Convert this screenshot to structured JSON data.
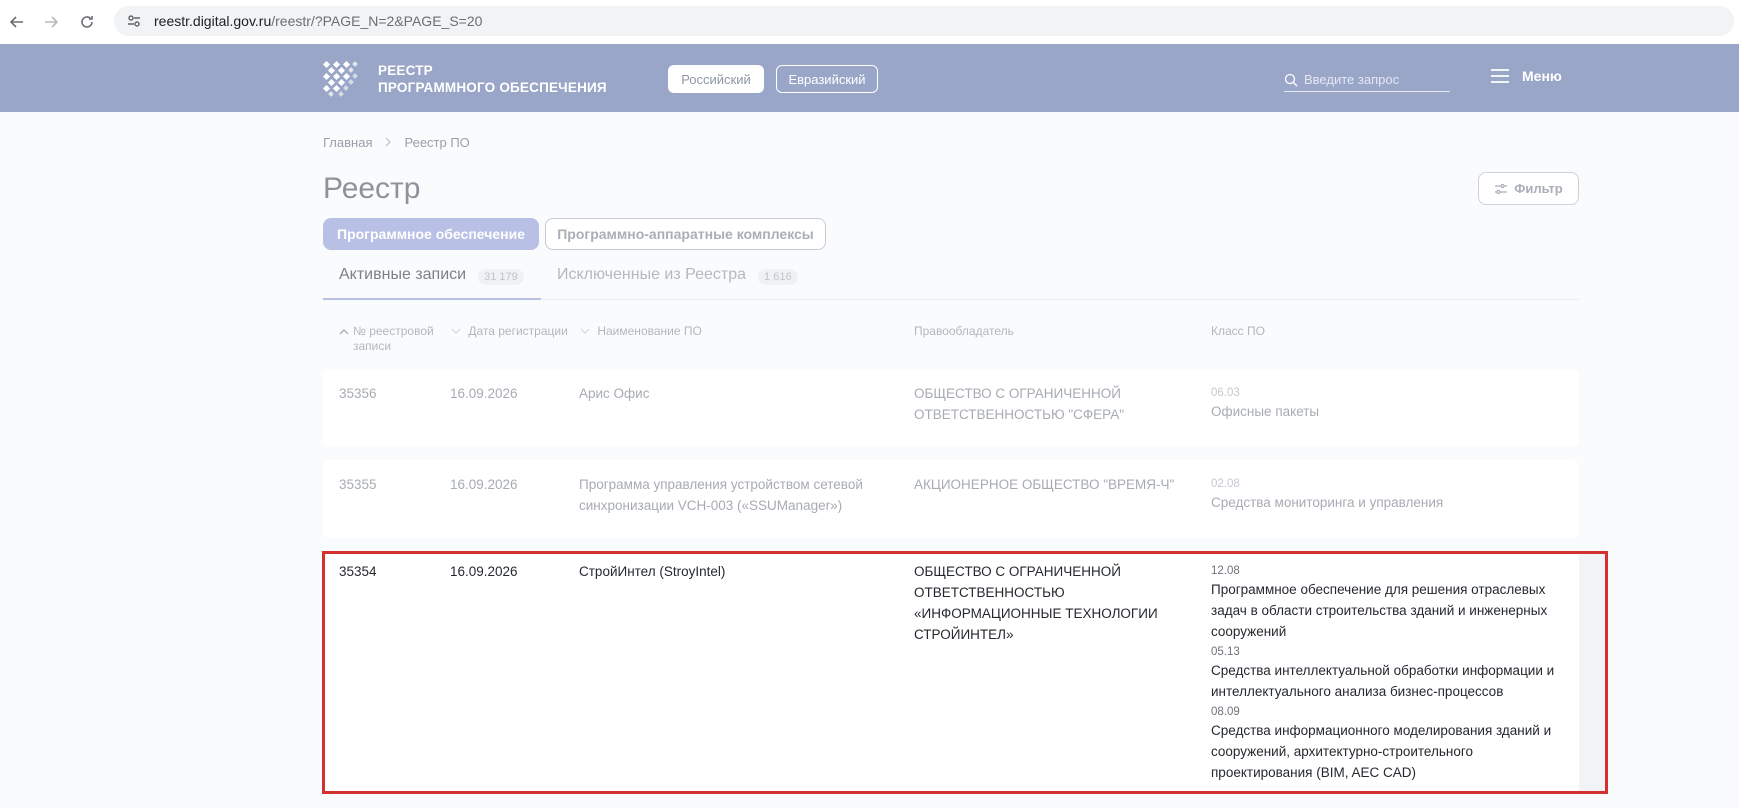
{
  "browser": {
    "url_host": "reestr.digital.gov.ru",
    "url_path": "/reestr/?PAGE_N=2&PAGE_S=20"
  },
  "header": {
    "logo_line1": "РЕЕСТР",
    "logo_line2": "ПРОГРАММНОГО ОБЕСПЕЧЕНИЯ",
    "btn_russian": "Российский",
    "btn_eurasian": "Евразийский",
    "search_placeholder": "Введите запрос",
    "menu_label": "Меню"
  },
  "breadcrumb": [
    "Главная",
    "Реестр ПО"
  ],
  "page_title": "Реестр",
  "filter_label": "Фильтр",
  "categories": [
    "Программное обеспечение",
    "Программно-аппаратные комплексы"
  ],
  "tabs": [
    {
      "label": "Активные записи",
      "count": "31 179"
    },
    {
      "label": "Исключенные из Реестра",
      "count": "1 616"
    }
  ],
  "columns": {
    "num": "№ реестровой записи",
    "date": "Дата регистрации",
    "name": "Наименование ПО",
    "owner": "Правообладатель",
    "class": "Класс ПО"
  },
  "rows": [
    {
      "num": "35356",
      "date": "16.09.2026",
      "name": "Арис Офис",
      "owner": "ОБЩЕСТВО С ОГРАНИЧЕННОЙ ОТВЕТСТВЕННОСТЬЮ \"СФЕРА\"",
      "classes": [
        {
          "code": "06.03",
          "name": "Офисные пакеты"
        }
      ]
    },
    {
      "num": "35355",
      "date": "16.09.2026",
      "name": "Программа управления устройством сетевой синхронизации VCH-003 («SSUManager»)",
      "owner": "АКЦИОНЕРНОЕ ОБЩЕСТВО \"ВРЕМЯ-Ч\"",
      "classes": [
        {
          "code": "02.08",
          "name": "Средства мониторинга и управления"
        }
      ]
    },
    {
      "num": "35354",
      "date": "16.09.2026",
      "name": "СтройИнтел (StroyIntel)",
      "owner": "ОБЩЕСТВО С ОГРАНИЧЕННОЙ ОТВЕТСТВЕННОСТЬЮ «ИНФОРМАЦИОННЫЕ ТЕХНОЛОГИИ СТРОЙИНТЕЛ»",
      "classes": [
        {
          "code": "12.08",
          "name": "Программное обеспечение для решения отраслевых задач в области строительства зданий и инженерных сооружений"
        },
        {
          "code": "05.13",
          "name": "Средства интеллектуальной обработки информации и интеллектуального анализа бизнес-процессов"
        },
        {
          "code": "08.09",
          "name": "Средства информационного моделирования зданий и сооружений, архитектурно-строительного проектирования (BIM, AEC CAD)"
        }
      ]
    }
  ],
  "colors": {
    "header_bg": "#9aa6c8",
    "accent": "#b9c0e5",
    "highlight": "#d33030"
  }
}
